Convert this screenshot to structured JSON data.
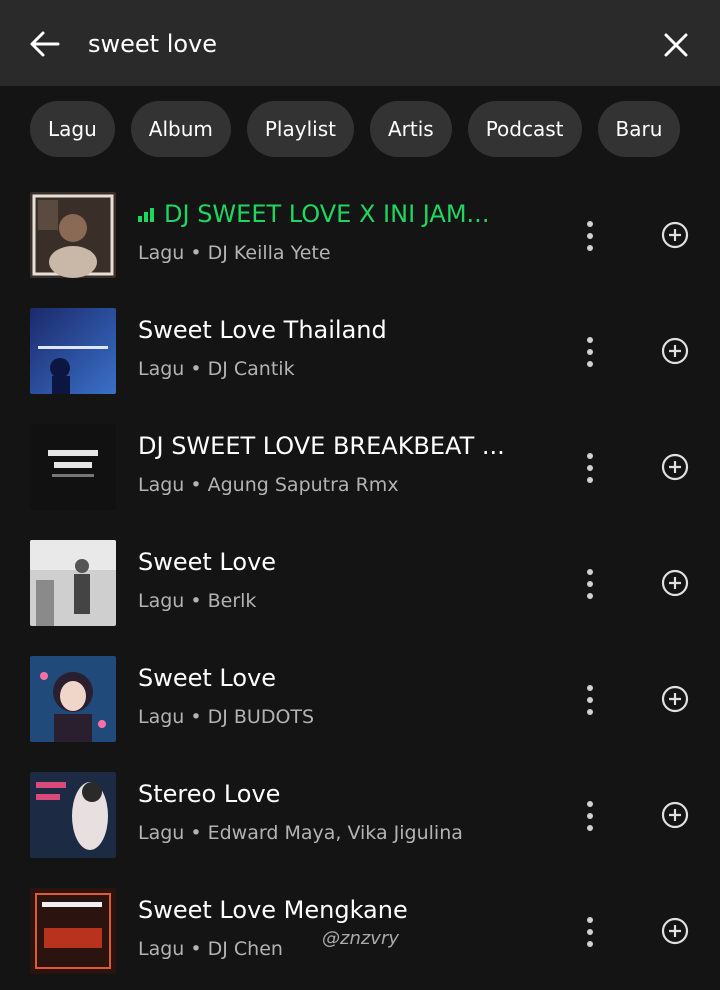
{
  "search": {
    "query": "sweet love"
  },
  "filters": [
    "Lagu",
    "Album",
    "Playlist",
    "Artis",
    "Podcast",
    "Baru"
  ],
  "results": [
    {
      "title": "DJ SWEET LOVE X INI JAM...",
      "subtitle": "Lagu • DJ Keilla Yete",
      "playing": true
    },
    {
      "title": "Sweet Love Thailand",
      "subtitle": "Lagu • DJ Cantik",
      "playing": false
    },
    {
      "title": "DJ SWEET LOVE BREAKBEAT ...",
      "subtitle": "Lagu • Agung Saputra Rmx",
      "playing": false
    },
    {
      "title": "Sweet Love",
      "subtitle": "Lagu • Berlk",
      "playing": false
    },
    {
      "title": "Sweet Love",
      "subtitle": "Lagu • DJ BUDOTS",
      "playing": false
    },
    {
      "title": "Stereo Love",
      "subtitle": "Lagu • Edward Maya, Vika Jigulina",
      "playing": false
    },
    {
      "title": "Sweet Love Mengkane",
      "subtitle": "Lagu • DJ Chen",
      "playing": false
    }
  ],
  "icons": {
    "back": "arrow-left-icon",
    "clear": "close-icon",
    "more": "more-vertical-icon",
    "add": "add-circle-icon",
    "playing": "equalizer-icon"
  },
  "colors": {
    "accent": "#1ed760",
    "chip_bg": "#333333",
    "header_bg": "#2a2a2a"
  },
  "watermark": "@znzvry"
}
